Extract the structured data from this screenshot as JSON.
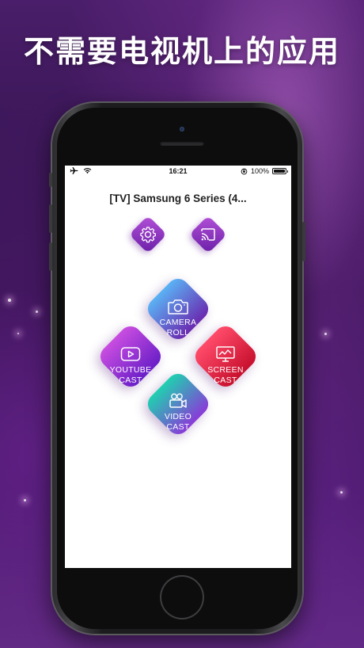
{
  "banner": {
    "headline": "不需要电视机上的应用"
  },
  "status_bar": {
    "time": "16:21",
    "battery_percent": "100%",
    "battery_level": 1.0
  },
  "app": {
    "tv_name": "[TV] Samsung 6 Series (4...",
    "top_buttons": [
      {
        "icon": "gear-icon"
      },
      {
        "icon": "cast-icon"
      }
    ],
    "tiles": {
      "camera_roll": {
        "line1": "CAMERA",
        "line2": "ROLL",
        "icon": "camera-icon"
      },
      "youtube_cast": {
        "line1": "YOUTUBE",
        "line2": "CAST",
        "icon": "play-icon"
      },
      "screen_cast": {
        "line1": "SCREEN",
        "line2": "CAST",
        "icon": "monitor-icon"
      },
      "video_cast": {
        "line1": "VIDEO",
        "line2": "CAST",
        "icon": "video-camera-icon"
      }
    }
  },
  "colors": {
    "camera_roll": [
      "#5ab2f4",
      "#6a2ab0"
    ],
    "youtube_cast": [
      "#c94de0",
      "#6a1fc8"
    ],
    "screen_cast": [
      "#ff4b6a",
      "#c8102e"
    ],
    "video_cast": [
      "#1fd0b0",
      "#8a3ad8"
    ]
  }
}
